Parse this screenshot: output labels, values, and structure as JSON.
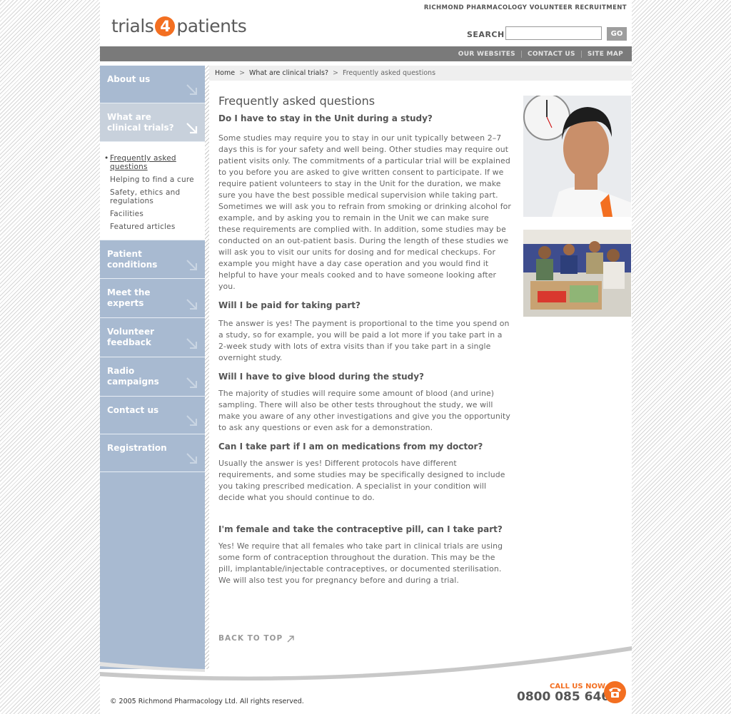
{
  "header": {
    "org_name": "RICHMOND PHARMACOLOGY VOLUNTEER RECRUITMENT",
    "logo_part1": "trials",
    "logo_number": "4",
    "logo_part2": "patients",
    "search_label": "SEARCH",
    "search_value": "",
    "go_label": "GO"
  },
  "topnav": [
    "OUR WEBSITES",
    "CONTACT US",
    "SITE MAP"
  ],
  "sidebar": {
    "about": "About us",
    "clinical_line1": "What are",
    "clinical_line2": "clinical trials?",
    "sub_items": [
      {
        "line1": "Frequently asked",
        "line2": "questions"
      },
      {
        "line1": "Helping to find a cure",
        "line2": ""
      },
      {
        "line1": "Safety, ethics and",
        "line2": "regulations"
      },
      {
        "line1": "Facilities",
        "line2": ""
      },
      {
        "line1": "Featured articles",
        "line2": ""
      }
    ],
    "patient_line1": "Patient",
    "patient_line2": "conditions",
    "experts_line1": "Meet the",
    "experts_line2": "experts",
    "volunteer_line1": "Volunteer",
    "volunteer_line2": "feedback",
    "radio_line1": "Radio",
    "radio_line2": "campaigns",
    "contact": "Contact us",
    "registration": "Registration"
  },
  "breadcrumb": {
    "home": "Home",
    "section": "What are clinical trials?",
    "current": "Frequently asked questions",
    "separator": ">"
  },
  "content": {
    "title": "Frequently asked questions",
    "faqs": [
      {
        "q": "Do I have to stay in the Unit during a study?",
        "a": "Some studies may require you to stay in our unit typically between 2–7 days this is for your safety and well being. Other studies may require out patient visits only. The commitments of a particular trial will be explained to you before you are asked to give written consent to participate. If we require patient volunteers to stay in the Unit for the duration, we make sure you have the best possible medical supervision while taking part. Sometimes we will ask you to refrain from smoking or drinking alcohol for example, and by asking you to remain in the Unit we can make sure these requirements are complied with. In addition, some studies may be conducted on an out-patient basis. During the length of these studies we will ask you to visit our units for dosing and for medical checkups. For example you might have a day case operation and you would find it helpful to have your meals cooked and to have someone looking after you."
      },
      {
        "q": "Will I be paid for taking part?",
        "a": "The answer is yes! The payment is proportional to the time you spend on a study, so for example, you will be paid a lot more if you take part in a 2-week study with lots of extra visits than if you take part in a single overnight study."
      },
      {
        "q": "Will I have to give blood during the study?",
        "a": "The majority of studies will require some amount of blood (and urine) sampling. There will also be other tests throughout the study, we will make you aware of any other investigations and give you the opportunity to ask any questions or even ask for a demonstration."
      },
      {
        "q": "Can I take part if I am on medications from my doctor?",
        "a": "Usually the answer is yes! Different protocols have different requirements, and some studies may be specifically designed to include you taking prescribed medication. A specialist in your condition will decide what you should continue to do."
      },
      {
        "q": "I'm female and take the contraceptive pill, can I take part?",
        "a": "Yes! We require that all females who take part in clinical trials are using some form of contraception throughout the duration. This may be the pill, implantable/injectable contraceptives, or documented sterilisation. We will also test you for pregnancy before and during a trial."
      }
    ],
    "back_to_top": "BACK TO TOP"
  },
  "footer": {
    "copyright": "© 2005 Richmond Pharmacology Ltd. All rights reserved.",
    "call_us": "CALL US NOW",
    "phone": "0800 085 6464"
  },
  "colors": {
    "brand_orange": "#f36f21",
    "sidebar_blue": "#a8bad1",
    "nav_grey": "#7a7a7a"
  }
}
